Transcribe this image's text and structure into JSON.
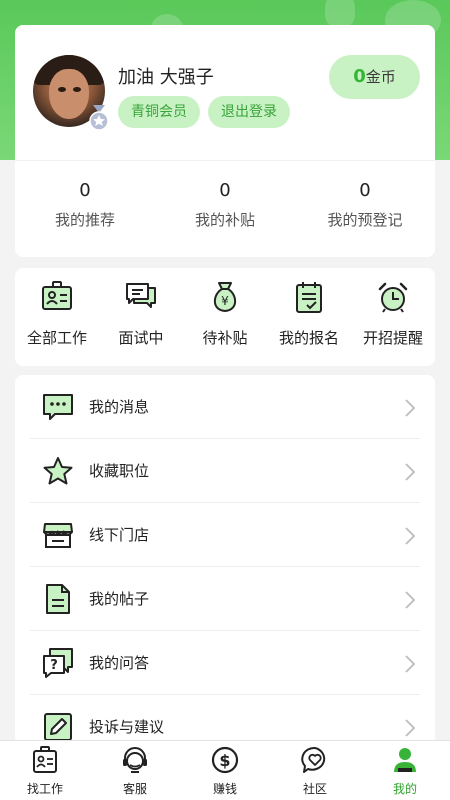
{
  "profile": {
    "username": "加油 大强子",
    "membership_tag": "青铜会员",
    "logout_label": "退出登录",
    "coins": {
      "value": "0",
      "unit": "金币"
    }
  },
  "stats": [
    {
      "value": "0",
      "label": "我的推荐"
    },
    {
      "value": "0",
      "label": "我的补贴"
    },
    {
      "value": "0",
      "label": "我的预登记"
    }
  ],
  "quick_menu": [
    {
      "label": "全部工作",
      "icon": "id-card-icon"
    },
    {
      "label": "面试中",
      "icon": "chat-bubbles-icon"
    },
    {
      "label": "待补贴",
      "icon": "money-bag-icon"
    },
    {
      "label": "我的报名",
      "icon": "clipboard-icon"
    },
    {
      "label": "开招提醒",
      "icon": "alarm-clock-icon"
    }
  ],
  "menu_list": [
    {
      "label": "我的消息",
      "icon": "message-icon"
    },
    {
      "label": "收藏职位",
      "icon": "star-icon"
    },
    {
      "label": "线下门店",
      "icon": "store-icon"
    },
    {
      "label": "我的帖子",
      "icon": "document-icon"
    },
    {
      "label": "我的问答",
      "icon": "question-icon"
    },
    {
      "label": "投诉与建议",
      "icon": "edit-icon"
    }
  ],
  "tabbar": [
    {
      "label": "找工作",
      "icon": "job-badge-icon",
      "active": false
    },
    {
      "label": "客服",
      "icon": "headset-icon",
      "active": false
    },
    {
      "label": "赚钱",
      "icon": "dollar-icon",
      "active": false
    },
    {
      "label": "社区",
      "icon": "heart-chat-icon",
      "active": false
    },
    {
      "label": "我的",
      "icon": "user-icon",
      "active": true
    }
  ],
  "colors": {
    "brand_green": "#5ac85a",
    "icon_fill": "#c9f2c4",
    "tag_text": "#39a43a",
    "active_tab": "#2ea52e"
  }
}
